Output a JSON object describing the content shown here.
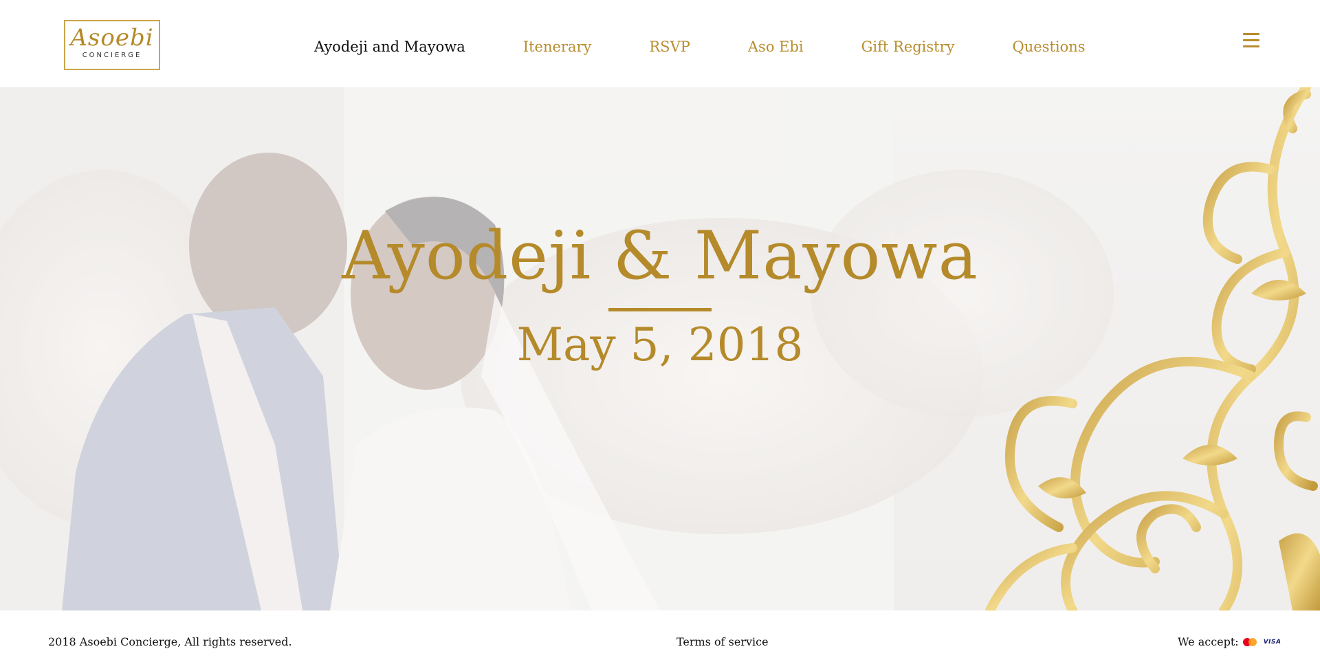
{
  "brand": {
    "logo_script": "Asoebi",
    "logo_sub": "CONCIERGE"
  },
  "nav": {
    "items": [
      {
        "label": "Ayodeji and Mayowa",
        "active": true
      },
      {
        "label": "Itenerary",
        "active": false
      },
      {
        "label": "RSVP",
        "active": false
      },
      {
        "label": "Aso Ebi",
        "active": false
      },
      {
        "label": "Gift Registry",
        "active": false
      },
      {
        "label": "Questions",
        "active": false
      }
    ],
    "menu_icon": "hamburger-menu-icon"
  },
  "hero": {
    "title": "Ayodeji & Mayowa",
    "date": "May 5, 2018"
  },
  "footer": {
    "copyright": "2018 Asoebi Concierge, All rights reserved.",
    "terms": "Terms of service",
    "accept_label": "We accept:",
    "payment_icons": [
      "mastercard-icon",
      "visa-icon"
    ],
    "visa_text": "VISA"
  },
  "colors": {
    "accent_gold": "#b58a2a",
    "nav_gold": "#b88d2e",
    "text_dark": "#111111",
    "background": "#ffffff"
  }
}
